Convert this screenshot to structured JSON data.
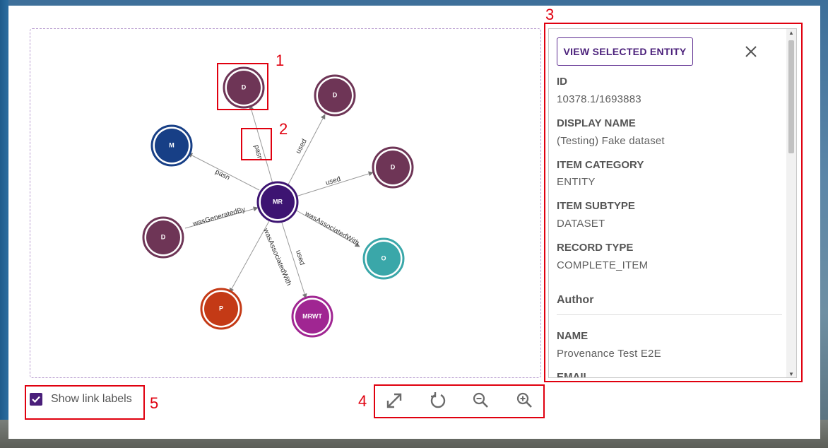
{
  "graph": {
    "center": {
      "label": "MR",
      "color": "#3d1472"
    },
    "nodes": [
      {
        "label": "D",
        "color": "#6e3556"
      },
      {
        "label": "D",
        "color": "#6e3556"
      },
      {
        "label": "M",
        "color": "#173f86"
      },
      {
        "label": "D",
        "color": "#6e3556"
      },
      {
        "label": "D",
        "color": "#6e3556"
      },
      {
        "label": "O",
        "color": "#3aa7a9"
      },
      {
        "label": "P",
        "color": "#c43a16"
      },
      {
        "label": "MRWT",
        "color": "#a02692"
      }
    ],
    "edges": [
      {
        "label": "pasn"
      },
      {
        "label": "used"
      },
      {
        "label": "pasn"
      },
      {
        "label": "used"
      },
      {
        "label": "wasGeneratedBy"
      },
      {
        "label": "wasAssociatedWith"
      },
      {
        "label": "wasAssociatedWith"
      },
      {
        "label": "used"
      }
    ]
  },
  "details": {
    "view_button": "VIEW SELECTED ENTITY",
    "fields": [
      {
        "label": "ID",
        "value": "10378.1/1693883"
      },
      {
        "label": "DISPLAY NAME",
        "value": "(Testing) Fake dataset"
      },
      {
        "label": "ITEM CATEGORY",
        "value": "ENTITY"
      },
      {
        "label": "ITEM SUBTYPE",
        "value": "DATASET"
      },
      {
        "label": "RECORD TYPE",
        "value": "COMPLETE_ITEM"
      }
    ],
    "author_section": "Author",
    "author_fields": [
      {
        "label": "NAME",
        "value": "Provenance Test E2E"
      },
      {
        "label": "EMAIL",
        "value": ""
      }
    ]
  },
  "controls": {
    "show_link_labels": "Show link labels",
    "show_link_labels_checked": true
  },
  "annotations": [
    "1",
    "2",
    "3",
    "4",
    "5"
  ],
  "colors": {
    "accent": "#4a1f7a",
    "highlight": "#e0000f"
  }
}
